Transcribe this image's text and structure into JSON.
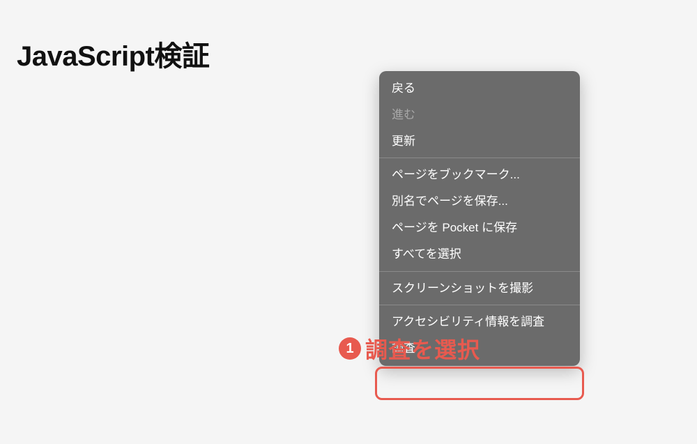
{
  "page": {
    "title": "JavaScript検証"
  },
  "contextMenu": {
    "items": [
      {
        "label": "戻る",
        "disabled": false
      },
      {
        "label": "進む",
        "disabled": true
      },
      {
        "label": "更新",
        "disabled": false
      }
    ],
    "group2": [
      {
        "label": "ページをブックマーク..."
      },
      {
        "label": "別名でページを保存..."
      },
      {
        "label": "ページを Pocket に保存"
      },
      {
        "label": "すべてを選択"
      }
    ],
    "group3": [
      {
        "label": "スクリーンショットを撮影"
      }
    ],
    "group4": [
      {
        "label": "アクセシビリティ情報を調査"
      },
      {
        "label": "調査"
      }
    ]
  },
  "annotation": {
    "badge": "1",
    "text": "調査を選択"
  }
}
